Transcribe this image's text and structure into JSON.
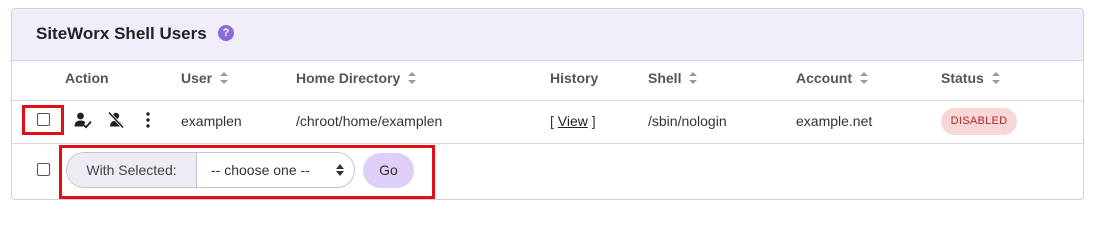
{
  "panel": {
    "title": "SiteWorx Shell Users",
    "help_glyph": "?"
  },
  "table": {
    "columns": {
      "action": "Action",
      "user": "User",
      "home_directory": "Home Directory",
      "history": "History",
      "shell": "Shell",
      "account": "Account",
      "status": "Status"
    },
    "row": {
      "user": "examplen",
      "home_directory": "/chroot/home/examplen",
      "history_open": "[",
      "history_link": "View",
      "history_close": "]",
      "shell": "/sbin/nologin",
      "account": "example.net",
      "status": "DISABLED"
    }
  },
  "bulk": {
    "label": "With Selected:",
    "select_value": "-- choose one --",
    "go_label": "Go"
  },
  "colors": {
    "header_bg": "#f2eef9",
    "status_bg": "#f8d7d7",
    "status_text": "#b3262d",
    "go_bg": "#ddcff7",
    "highlight": "#e0101b",
    "help_icon": "#8d6ad9"
  },
  "icons": [
    "help-icon",
    "sort-icon",
    "user-edit-icon",
    "user-disable-icon",
    "more-vertical-icon",
    "select-caret-icon"
  ]
}
